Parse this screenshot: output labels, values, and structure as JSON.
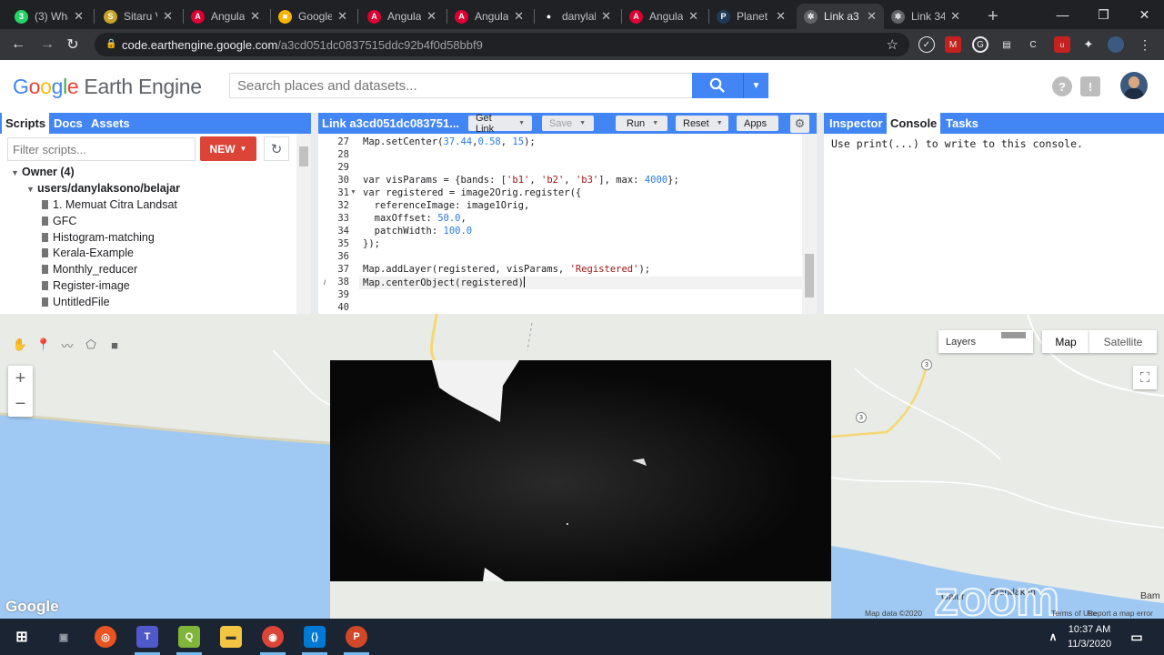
{
  "browser": {
    "tabs": [
      {
        "label": "(3) Wha",
        "icon": "whatsapp-icon",
        "color": "#25d366",
        "glyph": "3"
      },
      {
        "label": "Sitaru V",
        "icon": "sitaru-icon",
        "color": "#c7a52a",
        "glyph": "S"
      },
      {
        "label": "Angula",
        "icon": "angular-icon",
        "color": "#dd0031",
        "glyph": "A"
      },
      {
        "label": "Google",
        "icon": "google-slides-icon",
        "color": "#f4b400",
        "glyph": "■"
      },
      {
        "label": "Angula",
        "icon": "angular-icon",
        "color": "#dd0031",
        "glyph": "A"
      },
      {
        "label": "Angula",
        "icon": "angular-icon",
        "color": "#dd0031",
        "glyph": "A"
      },
      {
        "label": "danylal",
        "icon": "github-icon",
        "color": "#202124",
        "glyph": "●"
      },
      {
        "label": "Angula",
        "icon": "angular-icon",
        "color": "#dd0031",
        "glyph": "A"
      },
      {
        "label": "Planet",
        "icon": "planet-icon",
        "color": "#1f3b57",
        "glyph": "P"
      },
      {
        "label": "Link a3",
        "icon": "earth-engine-icon",
        "color": "#5f6368",
        "glyph": "✲"
      },
      {
        "label": "Link 34",
        "icon": "earth-engine-icon",
        "color": "#5f6368",
        "glyph": "✲"
      }
    ],
    "new_tab": "+",
    "url_host": "code.earthengine.google.com",
    "url_path": "/a3cd051dc0837515ddc92b4f0d58bbf9"
  },
  "gee": {
    "logo_google": [
      "G",
      "o",
      "o",
      "g",
      "l",
      "e"
    ],
    "logo_product": "Earth Engine",
    "search_placeholder": "Search places and datasets...",
    "help": "?",
    "left_tabs": [
      "Scripts",
      "Docs",
      "Assets"
    ],
    "filter_placeholder": "Filter scripts...",
    "new_label": "NEW",
    "owner_label": "Owner (4)",
    "repo_label": "users/danylaksono/belajar",
    "files": [
      "1. Memuat Citra Landsat",
      "GFC",
      "Histogram-matching",
      "Kerala-Example",
      "Monthly_reducer",
      "Register-image",
      "UntitledFile"
    ],
    "editor_title": "Link a3cd051dc083751...",
    "editor_buttons": {
      "get_link": "Get Link",
      "save": "Save",
      "run": "Run",
      "reset": "Reset",
      "apps": "Apps"
    },
    "right_tabs": [
      "Inspector",
      "Console",
      "Tasks"
    ],
    "console_text": "Use print(...) to write to this console.",
    "code_lines": [
      {
        "n": "27",
        "text": "Map.setCenter(37.44,0.58, 15);"
      },
      {
        "n": "28",
        "text": ""
      },
      {
        "n": "29",
        "text": ""
      },
      {
        "n": "30",
        "text": "var visParams = {bands: ['b1', 'b2', 'b3'], max: 4000};"
      },
      {
        "n": "31",
        "text": "var registered = image2Orig.register({"
      },
      {
        "n": "32",
        "text": "  referenceImage: image1Orig,"
      },
      {
        "n": "33",
        "text": "  maxOffset: 50.0,"
      },
      {
        "n": "34",
        "text": "  patchWidth: 100.0"
      },
      {
        "n": "35",
        "text": "});"
      },
      {
        "n": "36",
        "text": ""
      },
      {
        "n": "37",
        "text": "Map.addLayer(registered, visParams, 'Registered');"
      },
      {
        "n": "38",
        "text": "Map.centerObject(registered)"
      },
      {
        "n": "39",
        "text": ""
      },
      {
        "n": "40",
        "text": ""
      }
    ]
  },
  "map": {
    "layers_label": "Layers",
    "map_label": "Map",
    "satellite_label": "Satellite",
    "zoom_in": "+",
    "zoom_out": "−",
    "google_logo": "Google",
    "map_data": "Map data ©2020",
    "terms": "Terms of Use",
    "report": "Report a map error",
    "places": [
      "Srandakan",
      "Galur",
      "Bam"
    ],
    "shields": [
      "3",
      "3"
    ],
    "watermark": "zoom"
  },
  "taskbar": {
    "time": "10:37 AM",
    "date": "11/3/2020"
  },
  "colors": {
    "gee_blue": "#4285f4",
    "new_red": "#db4437",
    "chrome_dark": "#202124",
    "taskbar": "#1b2433"
  }
}
